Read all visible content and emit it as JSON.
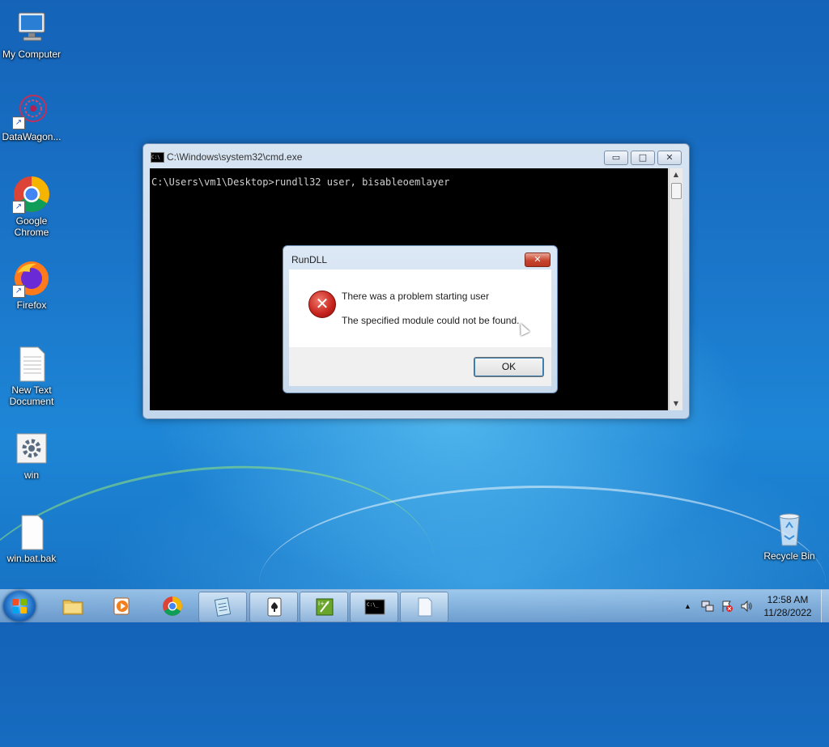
{
  "desktop": {
    "icons": [
      {
        "label": "My Computer",
        "icon": "computer-icon"
      },
      {
        "label": "DataWagon...",
        "icon": "datawagon-icon"
      },
      {
        "label": "Google Chrome",
        "icon": "chrome-icon"
      },
      {
        "label": "Firefox",
        "icon": "firefox-icon"
      },
      {
        "label": "New Text Document",
        "icon": "text-document-icon"
      },
      {
        "label": "win",
        "icon": "settings-file-icon"
      },
      {
        "label": "win.bat.bak",
        "icon": "blank-file-icon"
      },
      {
        "label": "Recycle Bin",
        "icon": "recycle-bin-icon"
      }
    ]
  },
  "cmd_window": {
    "title": "C:\\Windows\\system32\\cmd.exe",
    "line": "C:\\Users\\vm1\\Desktop>rundll32 user, bisableoemlayer",
    "minimize": "▭",
    "maximize": "□",
    "close": "✕"
  },
  "dialog": {
    "title": "RunDLL",
    "close": "✕",
    "message_1": "There was a problem starting user",
    "message_2": "The specified module could not be found.",
    "ok_label": "OK",
    "icon": "error-icon"
  },
  "taskbar": {
    "start": "start-button",
    "apps": [
      {
        "name": "file-explorer-icon",
        "active": false
      },
      {
        "name": "media-player-icon",
        "active": false
      },
      {
        "name": "chrome-icon",
        "active": false
      },
      {
        "name": "notepad-icon",
        "active": true
      },
      {
        "name": "solitaire-icon",
        "active": true
      },
      {
        "name": "editor-icon",
        "active": true
      },
      {
        "name": "cmd-icon",
        "active": true
      },
      {
        "name": "document-icon",
        "active": true
      }
    ],
    "tray_arrow": "▲",
    "time": "12:58 AM",
    "date": "11/28/2022"
  },
  "colors": {
    "cmd_bg": "#000000",
    "accent": "#1a74c8"
  }
}
